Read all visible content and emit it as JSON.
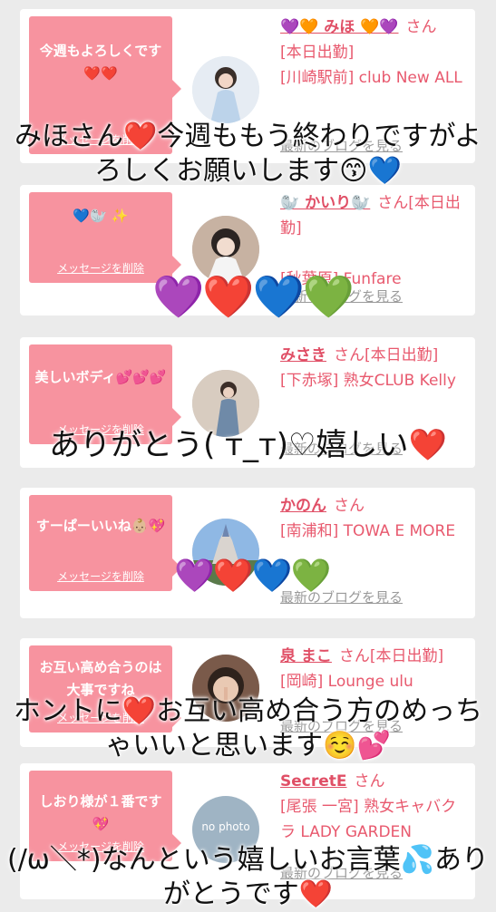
{
  "cards": [
    {
      "bubble_text": "今週もよろしくです❤️❤️",
      "delete_label": "メッセージを削除",
      "name": "💜🧡 みほ 🧡💜",
      "san": "さん",
      "status": "[本日出勤]",
      "place": "[川崎駅前] club New ALL",
      "blog_label": "最新のブログを見る"
    },
    {
      "bubble_text": "💙🦭 ✨",
      "delete_label": "メッセージを削除",
      "name": "🦭 かいり🦭",
      "san": "さん[本日出勤]",
      "status": "",
      "place": "[秋葉原] Funfare",
      "blog_label": "最新のブログを見る"
    },
    {
      "bubble_text": "美しいボディ💕💕💕",
      "delete_label": "メッセージを削除",
      "name": "みさき",
      "san": "さん[本日出勤]",
      "status": "",
      "place": "[下赤塚] 熟女CLUB Kelly",
      "blog_label": "最新のブログを見る"
    },
    {
      "bubble_text": "すーぱーいいね👶🏼💖",
      "delete_label": "メッセージを削除",
      "name": "かのん",
      "san": "さん",
      "status": "",
      "place": "[南浦和] TOWA E MORE",
      "blog_label": "最新のブログを見る"
    },
    {
      "bubble_text": "お互い高め合うのは大事ですね",
      "delete_label": "メッセージを削除",
      "name": "泉 まこ",
      "san": "さん[本日出勤]",
      "status": "",
      "place": "[岡崎] Lounge ulu",
      "blog_label": "最新のブログを見る"
    },
    {
      "bubble_text": "しおり様が１番です💖",
      "delete_label": "メッセージを削除",
      "name": "SecretE",
      "san": "さん",
      "status": "",
      "place": "[尾張 一宮] 熟女キャバクラ LADY GARDEN",
      "blog_label": "最新のブログを見る",
      "avatar_placeholder": "no photo"
    }
  ],
  "overlays": [
    "みほさん❤️今週ももう終わりですがよろしくお願いします😙💙",
    "ありがとう( ᴛ_ᴛ)♡嬉しい❤️",
    "ホントに❤️お互い高め合う方のめっちゃいいと思います☺️💕",
    "(/ω＼*)なんという嬉しいお言葉💦ありがとうです❤️"
  ],
  "hearts_row": [
    "💜",
    "❤️",
    "💙",
    "💚"
  ],
  "colors": {
    "background": "#ebebeb",
    "bubble": "#f7939f",
    "accent": "#e8596e",
    "muted": "#9a9a9a"
  }
}
